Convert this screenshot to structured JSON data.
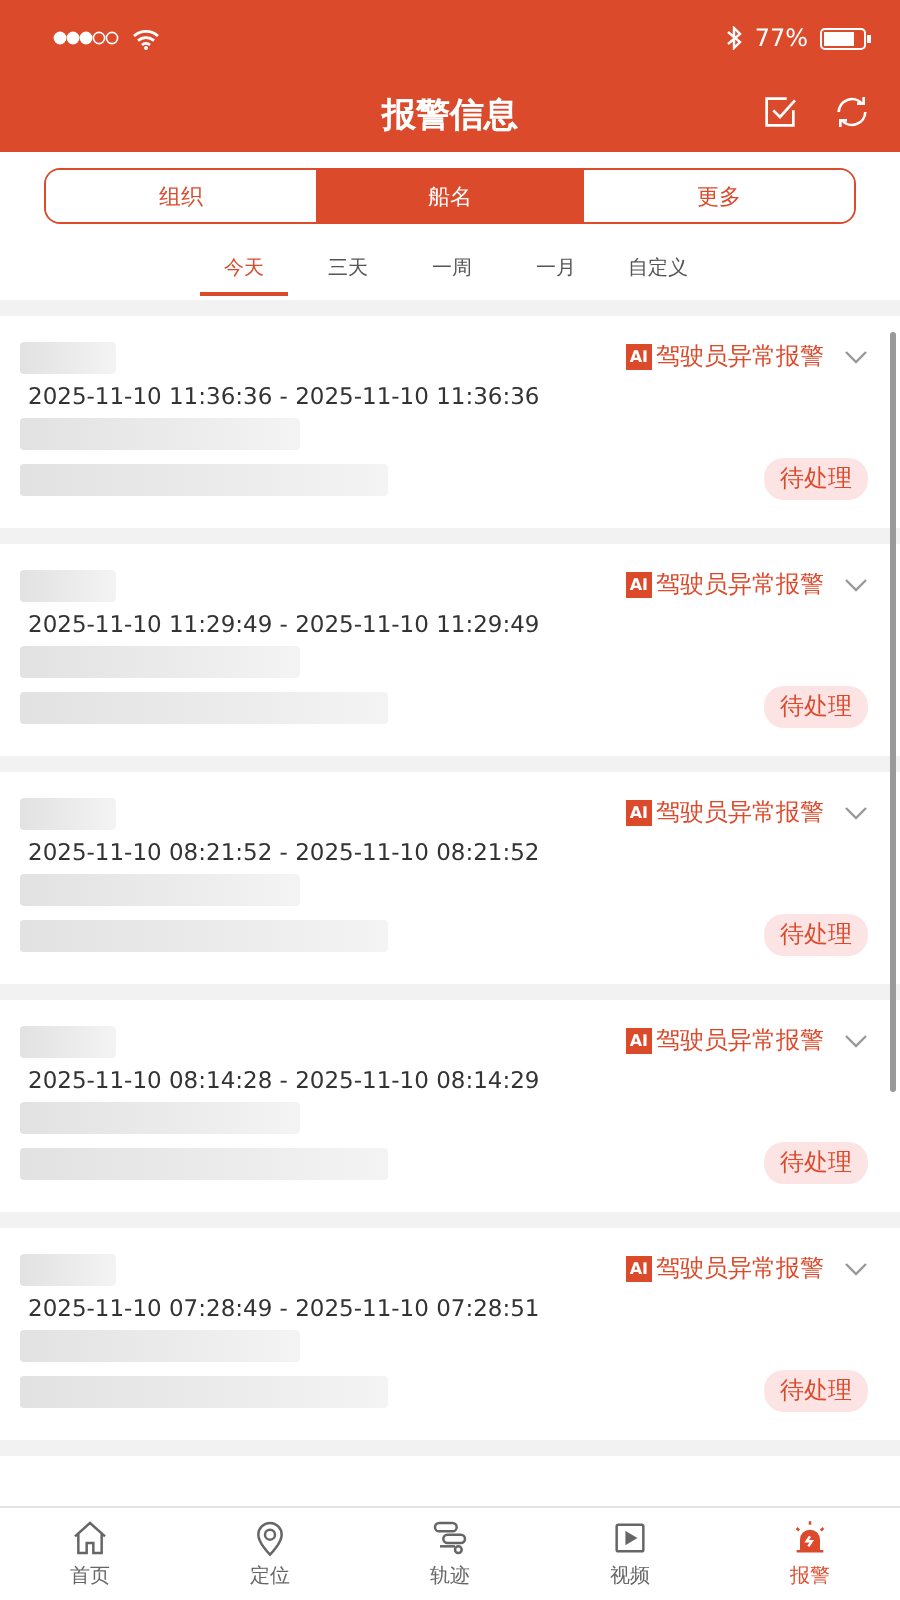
{
  "status_bar": {
    "battery": "77%"
  },
  "header": {
    "title": "报警信息"
  },
  "segments": [
    {
      "label": "组织",
      "selected": false
    },
    {
      "label": "船名",
      "selected": true
    },
    {
      "label": "更多",
      "selected": false
    }
  ],
  "date_tabs": [
    {
      "label": "今天",
      "selected": true
    },
    {
      "label": "三天",
      "selected": false
    },
    {
      "label": "一周",
      "selected": false
    },
    {
      "label": "一月",
      "selected": false
    },
    {
      "label": "自定义",
      "selected": false
    }
  ],
  "alerts": [
    {
      "badge": "AI",
      "type": "驾驶员异常报警",
      "time_range": "2025-11-10 11:36:36 - 2025-11-10 11:36:36",
      "status": "待处理"
    },
    {
      "badge": "AI",
      "type": "驾驶员异常报警",
      "time_range": "2025-11-10 11:29:49 - 2025-11-10 11:29:49",
      "status": "待处理"
    },
    {
      "badge": "AI",
      "type": "驾驶员异常报警",
      "time_range": "2025-11-10 08:21:52 - 2025-11-10 08:21:52",
      "status": "待处理"
    },
    {
      "badge": "AI",
      "type": "驾驶员异常报警",
      "time_range": "2025-11-10 08:14:28 - 2025-11-10 08:14:29",
      "status": "待处理"
    },
    {
      "badge": "AI",
      "type": "驾驶员异常报警",
      "time_range": "2025-11-10 07:28:49 - 2025-11-10 07:28:51",
      "status": "待处理"
    }
  ],
  "tab_bar": [
    {
      "label": "首页",
      "selected": false
    },
    {
      "label": "定位",
      "selected": false
    },
    {
      "label": "轨迹",
      "selected": false
    },
    {
      "label": "视频",
      "selected": false
    },
    {
      "label": "报警",
      "selected": true
    }
  ]
}
